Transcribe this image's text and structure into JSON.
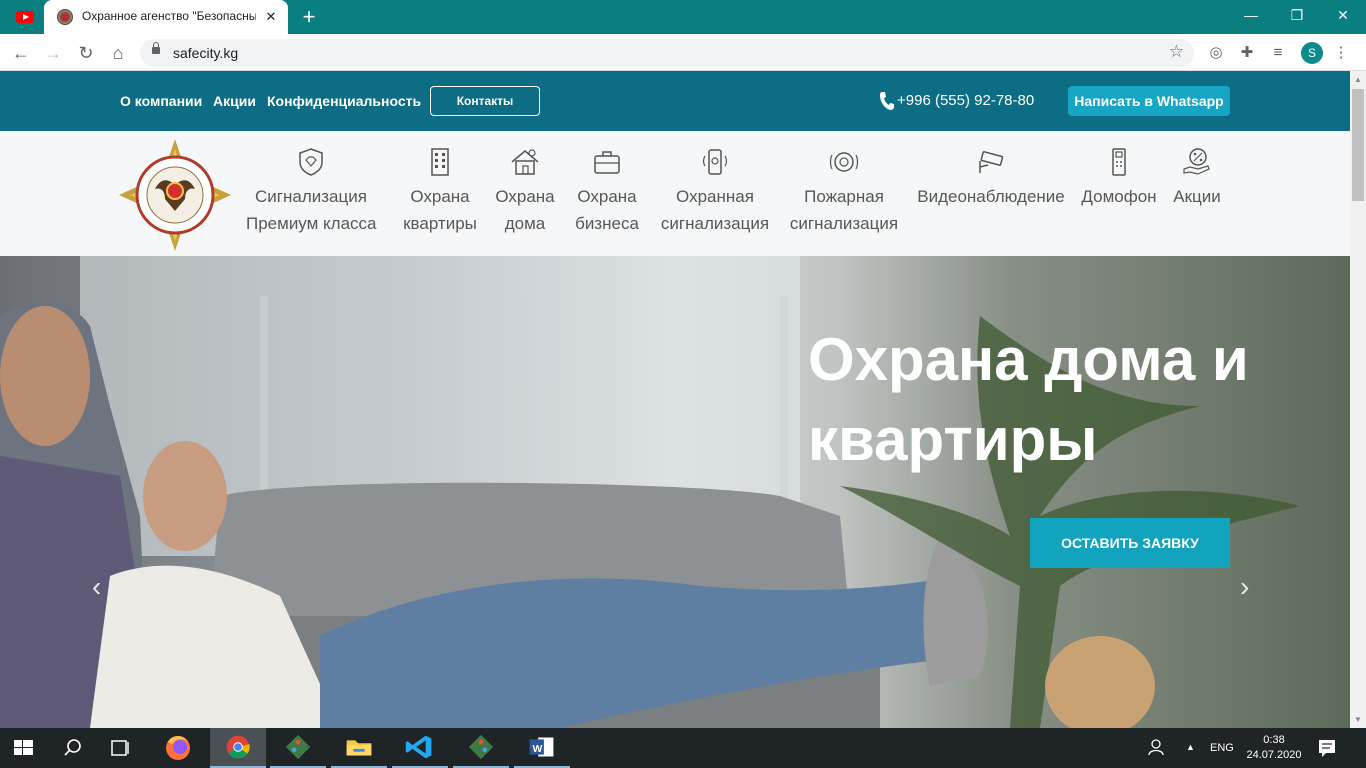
{
  "browser": {
    "tab_title": "Охранное агенство \"Безопасный город\"",
    "tab_close": "✕",
    "new_tab": "+",
    "url": "safecity.kg",
    "window_controls": [
      "—",
      "❐",
      "✕"
    ],
    "profile_initial": "S"
  },
  "site": {
    "top_links": [
      "О компании",
      "Акции",
      "Конфиденциальность"
    ],
    "contacts_button": "Контакты",
    "phone": "+996 (555) 92-78-80",
    "whatsapp_button": "Написать в Whatsapp",
    "nav_items": [
      {
        "line1": "Сигнализация",
        "line2": "Премиум класса",
        "icon": "diamond-shield-icon"
      },
      {
        "line1": "Охрана",
        "line2": "квартиры",
        "icon": "apartment-building-icon"
      },
      {
        "line1": "Охрана",
        "line2": "дома",
        "icon": "house-icon"
      },
      {
        "line1": "Охрана",
        "line2": "бизнеса",
        "icon": "briefcase-icon"
      },
      {
        "line1": "Охранная",
        "line2": "сигнализация",
        "icon": "alarm-phone-icon"
      },
      {
        "line1": "Пожарная",
        "line2": "сигнализация",
        "icon": "smoke-detector-icon"
      },
      {
        "line1": "Видеонаблюдение",
        "line2": "",
        "icon": "cctv-camera-icon"
      },
      {
        "line1": "Домофон",
        "line2": "",
        "icon": "intercom-icon"
      },
      {
        "line1": "Акции",
        "line2": "",
        "icon": "percent-hand-icon"
      }
    ],
    "hero": {
      "title": "Охрана дома и квартиры",
      "button": "ОСТАВИТЬ ЗАЯВКУ",
      "prev": "‹",
      "next": "›"
    }
  },
  "taskbar": {
    "lang": "ENG",
    "time": "0:38",
    "date": "24.07.2020"
  },
  "colors": {
    "chrome_frame": "#0b7f80",
    "topbar": "#0c6d85",
    "accent": "#12a4bf"
  }
}
